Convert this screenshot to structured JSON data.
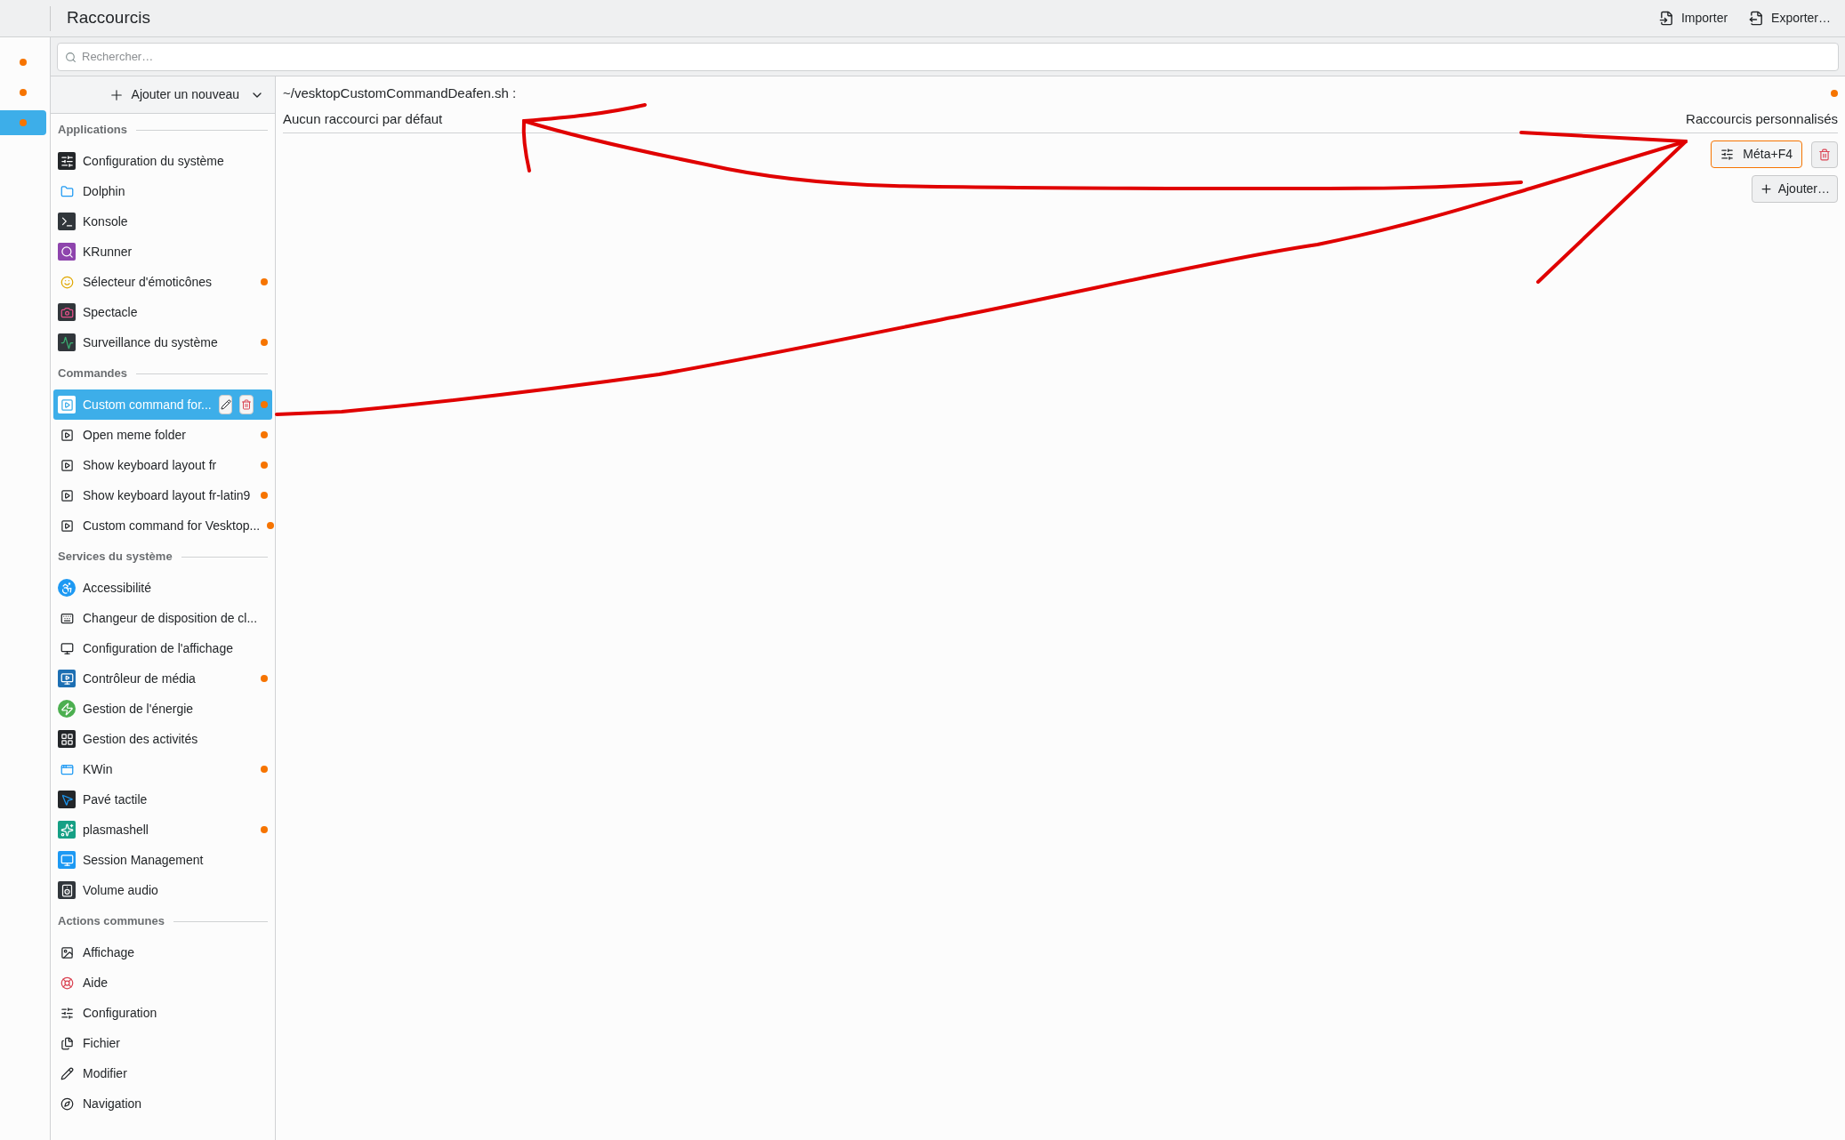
{
  "window": {
    "title": "Raccourcis"
  },
  "toolbar": [
    {
      "label": "Importer"
    },
    {
      "label": "Exporter…"
    }
  ],
  "nav_rail": [
    {
      "modified": true,
      "selected": false
    },
    {
      "modified": true,
      "selected": false
    },
    {
      "modified": true,
      "selected": true
    }
  ],
  "search": {
    "placeholder": "Rechercher…"
  },
  "add_new": {
    "label": "Ajouter un nouveau"
  },
  "sidebar": {
    "sections": [
      {
        "title": "Applications",
        "items": [
          {
            "label": "Configuration du système",
            "modified": false,
            "selected": false
          },
          {
            "label": "Dolphin",
            "modified": false,
            "selected": false
          },
          {
            "label": "Konsole",
            "modified": false,
            "selected": false
          },
          {
            "label": "KRunner",
            "modified": false,
            "selected": false
          },
          {
            "label": "Sélecteur d'émoticônes",
            "modified": true,
            "selected": false
          },
          {
            "label": "Spectacle",
            "modified": false,
            "selected": false
          },
          {
            "label": "Surveillance du système",
            "modified": true,
            "selected": false
          }
        ]
      },
      {
        "title": "Commandes",
        "items": [
          {
            "label": "Custom command for...",
            "modified": true,
            "selected": true
          },
          {
            "label": "Open meme folder",
            "modified": true,
            "selected": false
          },
          {
            "label": "Show keyboard layout fr",
            "modified": true,
            "selected": false
          },
          {
            "label": "Show keyboard layout fr-latin9",
            "modified": true,
            "selected": false
          },
          {
            "label": "Custom command for Vesktop...",
            "modified": true,
            "selected": false
          }
        ]
      },
      {
        "title": "Services du système",
        "items": [
          {
            "label": "Accessibilité",
            "modified": false,
            "selected": false
          },
          {
            "label": "Changeur de disposition de cl...",
            "modified": false,
            "selected": false
          },
          {
            "label": "Configuration de l'affichage",
            "modified": false,
            "selected": false
          },
          {
            "label": "Contrôleur de média",
            "modified": true,
            "selected": false
          },
          {
            "label": "Gestion de l'énergie",
            "modified": false,
            "selected": false
          },
          {
            "label": "Gestion des activités",
            "modified": false,
            "selected": false
          },
          {
            "label": "KWin",
            "modified": true,
            "selected": false
          },
          {
            "label": "Pavé tactile",
            "modified": false,
            "selected": false
          },
          {
            "label": "plasmashell",
            "modified": true,
            "selected": false
          },
          {
            "label": "Session Management",
            "modified": false,
            "selected": false
          },
          {
            "label": "Volume audio",
            "modified": false,
            "selected": false
          }
        ]
      },
      {
        "title": "Actions communes",
        "items": [
          {
            "label": "Affichage",
            "modified": false,
            "selected": false
          },
          {
            "label": "Aide",
            "modified": false,
            "selected": false
          },
          {
            "label": "Configuration",
            "modified": false,
            "selected": false
          },
          {
            "label": "Fichier",
            "modified": false,
            "selected": false
          },
          {
            "label": "Modifier",
            "modified": false,
            "selected": false
          },
          {
            "label": "Navigation",
            "modified": false,
            "selected": false
          }
        ]
      }
    ]
  },
  "detail": {
    "command": "~/vesktopCustomCommandDeafen.sh :",
    "modified": true,
    "default_text": "Aucun raccourci par défaut",
    "custom_heading": "Raccourcis personnalisés",
    "shortcuts": [
      {
        "label": "Méta+F4"
      }
    ],
    "add_button": "Ajouter…"
  }
}
